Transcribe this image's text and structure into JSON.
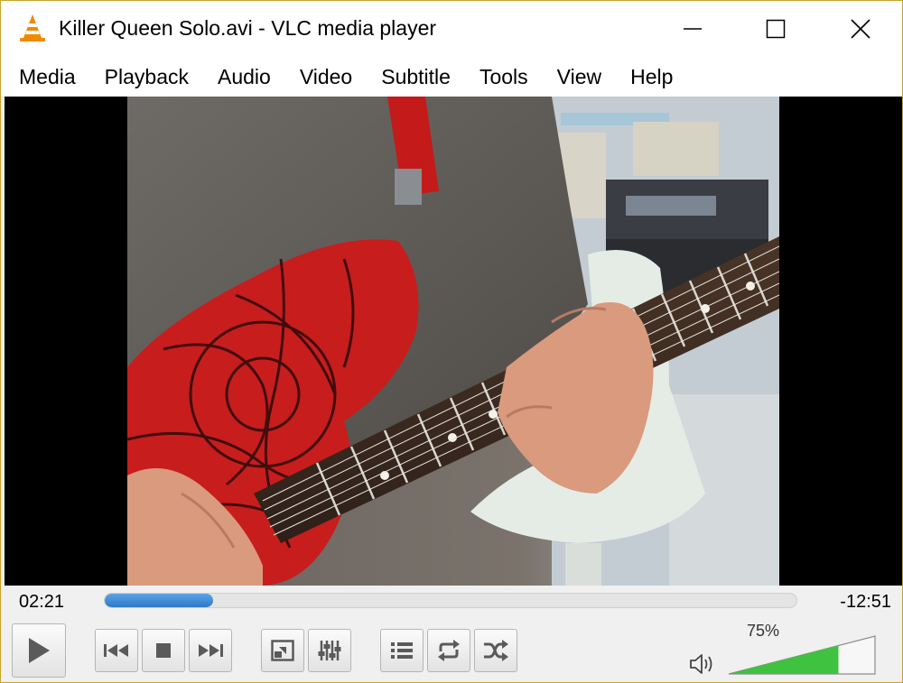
{
  "window": {
    "title": "Killer Queen Solo.avi - VLC media player",
    "app_icon": "vlc-cone-icon",
    "controls": [
      "minimize-icon",
      "maximize-icon",
      "close-icon"
    ]
  },
  "menu": [
    "Media",
    "Playback",
    "Audio",
    "Video",
    "Subtitle",
    "Tools",
    "View",
    "Help"
  ],
  "player": {
    "elapsed": "02:21",
    "remaining": "-12:51",
    "progress_fraction": 0.157,
    "volume_label": "75%",
    "volume_fraction": 0.75,
    "buttons": [
      "play-icon",
      "previous-icon",
      "stop-icon",
      "next-icon",
      "fullscreen-icon",
      "extended-settings-icon",
      "playlist-icon",
      "loop-icon",
      "shuffle-icon",
      "speaker-icon"
    ]
  },
  "colors": {
    "accent_blue": "#2c79c8",
    "volume_green": "#3fc23f",
    "vlc_orange": "#f08a00"
  }
}
